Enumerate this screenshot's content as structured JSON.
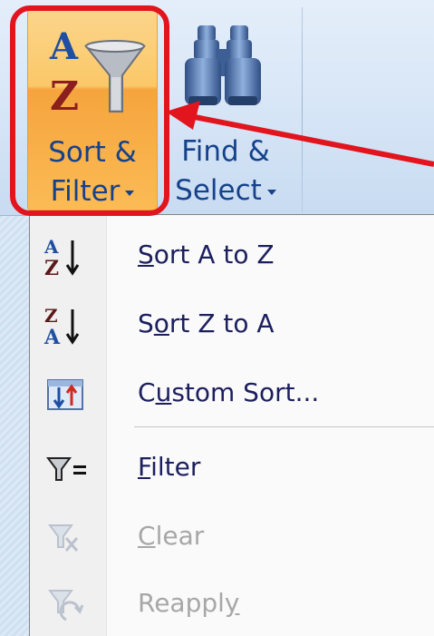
{
  "ribbon": {
    "sort_filter": {
      "line1": "Sort &",
      "line2": "Filter",
      "icon": "sort-filter-icon"
    },
    "find_select": {
      "line1": "Find &",
      "line2": "Select",
      "icon": "binoculars-icon"
    }
  },
  "menu": {
    "items": [
      {
        "pre": "",
        "access": "S",
        "post": "ort A to Z",
        "icon": "sort-a-to-z-icon",
        "enabled": true
      },
      {
        "pre": "S",
        "access": "o",
        "post": "rt Z to A",
        "icon": "sort-z-to-a-icon",
        "enabled": true
      },
      {
        "pre": "C",
        "access": "u",
        "post": "stom Sort...",
        "icon": "custom-sort-icon",
        "enabled": true
      },
      {
        "pre": "",
        "access": "F",
        "post": "ilter",
        "icon": "filter-icon",
        "enabled": true
      },
      {
        "pre": "",
        "access": "C",
        "post": "lear",
        "icon": "clear-filter-icon",
        "enabled": false
      },
      {
        "pre": "Reappl",
        "access": "y",
        "post": "",
        "icon": "reapply-filter-icon",
        "enabled": false
      }
    ]
  },
  "colors": {
    "highlight": "#e2141d",
    "ribbon_text": "#15428b",
    "menu_text": "#1c1f5e",
    "disabled_text": "#a7a7a7",
    "active_button": "#fbc868"
  }
}
